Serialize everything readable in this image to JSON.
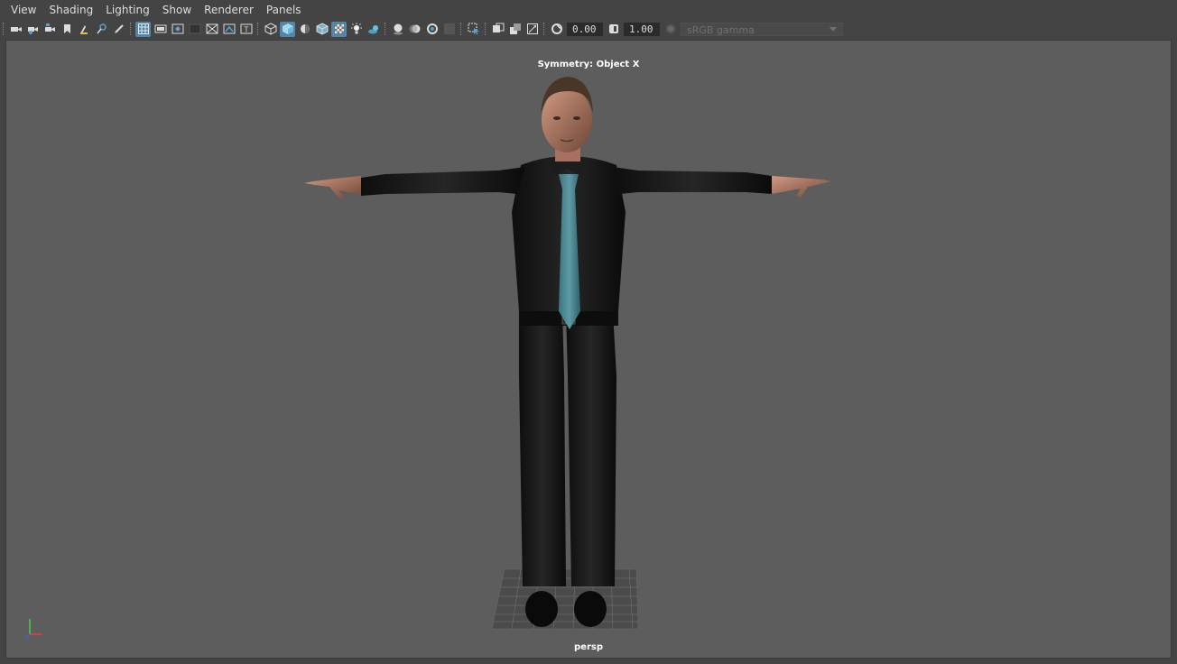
{
  "menu": {
    "items": [
      {
        "label": "View"
      },
      {
        "label": "Shading"
      },
      {
        "label": "Lighting"
      },
      {
        "label": "Show"
      },
      {
        "label": "Renderer"
      },
      {
        "label": "Panels"
      }
    ]
  },
  "toolbar": {
    "exposure_value": "0.00",
    "gamma_value": "1.00",
    "colorspace_label": "sRGB gamma",
    "icons": [
      "select-camera-icon",
      "camera-attributes-icon",
      "bookmarks-icon",
      "image-plane-icon",
      "2d-pan-zoom-icon",
      "grease-pencil-icon",
      "grid-icon",
      "film-gate-icon",
      "resolution-gate-icon",
      "gate-mask-icon",
      "field-chart-icon",
      "safe-action-icon",
      "safe-title-icon",
      "wireframe-icon",
      "smooth-shade-icon",
      "default-material-icon",
      "wireframe-on-shaded-icon",
      "xray-icon",
      "use-all-lights-icon",
      "shadows-icon",
      "screen-space-ao-icon",
      "motion-blur-icon",
      "multisample-aa-icon",
      "depth-of-field-icon",
      "isolate-select-icon",
      "xray-active-components-icon",
      "xray-joints-icon",
      "xray-icon-2",
      "exposure-icon",
      "gamma-icon",
      "view-transform-icon"
    ]
  },
  "viewport": {
    "symmetry_label": "Symmetry: Object X",
    "camera_label": "persp",
    "background_color": "#5d5d5d",
    "accent_color": "#5285a6"
  }
}
